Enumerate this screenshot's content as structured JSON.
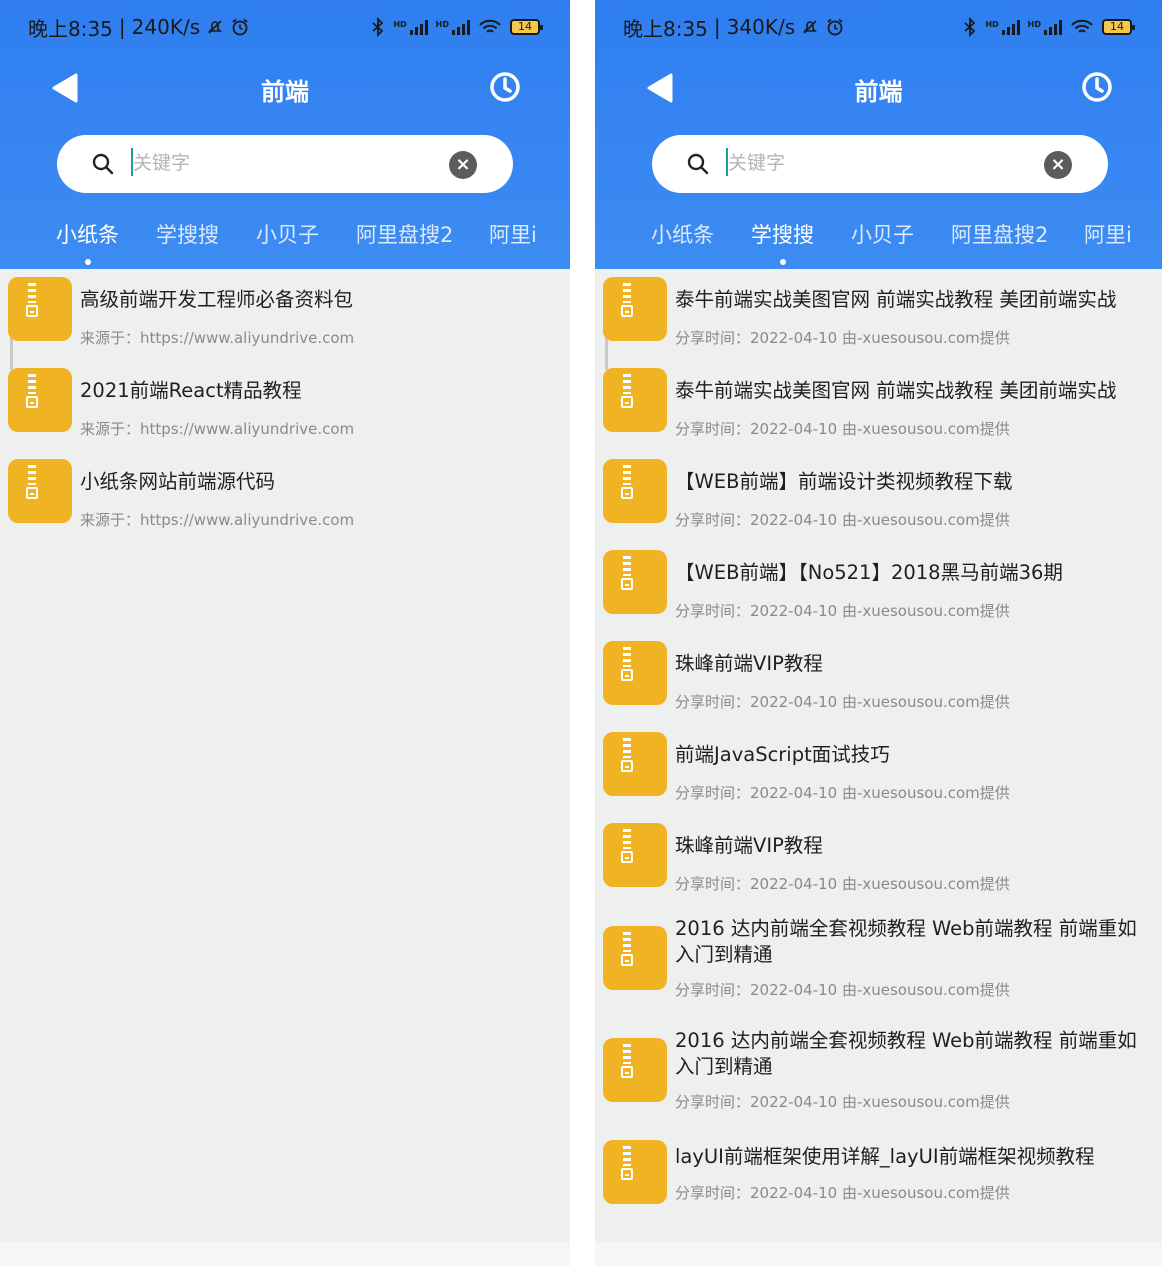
{
  "screens": [
    {
      "status": {
        "time": "晚上8:35",
        "speed": "240K/s",
        "battery": "14"
      },
      "nav": {
        "title": "前端"
      },
      "search": {
        "placeholder": "关键字"
      },
      "tabs": [
        {
          "label": "小纸条",
          "active": true
        },
        {
          "label": "学搜搜",
          "active": false
        },
        {
          "label": "小贝子",
          "active": false
        },
        {
          "label": "阿里盘搜2",
          "active": false
        },
        {
          "label": "阿里i",
          "active": false
        }
      ],
      "results": [
        {
          "title": "高级前端开发工程师必备资料包",
          "sub": "来源于：https://www.aliyundrive.com"
        },
        {
          "title": "2021前端React精品教程",
          "sub": "来源于：https://www.aliyundrive.com"
        },
        {
          "title": "小纸条网站前端源代码",
          "sub": "来源于：https://www.aliyundrive.com"
        }
      ]
    },
    {
      "status": {
        "time": "晚上8:35",
        "speed": "340K/s",
        "battery": "14"
      },
      "nav": {
        "title": "前端"
      },
      "search": {
        "placeholder": "关键字"
      },
      "tabs": [
        {
          "label": "小纸条",
          "active": false
        },
        {
          "label": "学搜搜",
          "active": true
        },
        {
          "label": "小贝子",
          "active": false
        },
        {
          "label": "阿里盘搜2",
          "active": false
        },
        {
          "label": "阿里i",
          "active": false
        }
      ],
      "results": [
        {
          "title": "泰牛前端实战美图官网 前端实战教程 美团前端实战",
          "sub": "分享时间：2022-04-10  由-xuesousou.com提供"
        },
        {
          "title": "泰牛前端实战美图官网 前端实战教程 美团前端实战",
          "sub": "分享时间：2022-04-10  由-xuesousou.com提供"
        },
        {
          "title": "【WEB前端】前端设计类视频教程下载",
          "sub": "分享时间：2022-04-10  由-xuesousou.com提供"
        },
        {
          "title": "【WEB前端】【No521】2018黑马前端36期",
          "sub": "分享时间：2022-04-10  由-xuesousou.com提供"
        },
        {
          "title": "珠峰前端VIP教程",
          "sub": "分享时间：2022-04-10  由-xuesousou.com提供"
        },
        {
          "title": "前端JavaScript面试技巧",
          "sub": "分享时间：2022-04-10  由-xuesousou.com提供"
        },
        {
          "title": "珠峰前端VIP教程",
          "sub": "分享时间：2022-04-10  由-xuesousou.com提供"
        },
        {
          "title": "2016 达内前端全套视频教程 Web前端教程 前端重如入门到精通",
          "sub": "分享时间：2022-04-10  由-xuesousou.com提供"
        },
        {
          "title": "2016 达内前端全套视频教程 Web前端教程 前端重如入门到精通",
          "sub": "分享时间：2022-04-10  由-xuesousou.com提供"
        },
        {
          "title": "layUI前端框架使用详解_layUI前端框架视频教程",
          "sub": "分享时间：2022-04-10  由-xuesousou.com提供"
        }
      ]
    }
  ]
}
